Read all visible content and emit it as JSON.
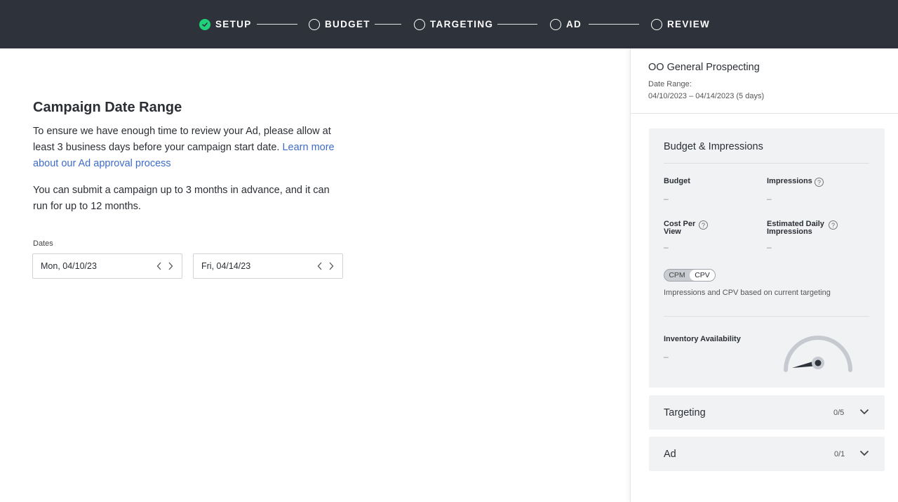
{
  "stepper": {
    "steps": [
      {
        "label": "SETUP",
        "status": "done"
      },
      {
        "label": "BUDGET",
        "status": "pending"
      },
      {
        "label": "TARGETING",
        "status": "pending"
      },
      {
        "label": "AD",
        "status": "pending"
      },
      {
        "label": "REVIEW",
        "status": "pending"
      }
    ]
  },
  "main": {
    "title": "Campaign Date Range",
    "para1_text": "To ensure we have enough time to review your Ad, please allow at least 3 business days before your campaign start date.",
    "para1_link": "Learn more about our Ad approval process",
    "para2": "You can submit a campaign up to 3 months in advance, and it can run for up to 12 months.",
    "dates_label": "Dates",
    "start_date": "Mon, 04/10/23",
    "end_date": "Fri, 04/14/23"
  },
  "summary": {
    "campaign_name": "OO General Prospecting",
    "date_range_label": "Date Range:",
    "date_range_value": "04/10/2023 – 04/14/2023 (5 days)",
    "budget_card": {
      "title": "Budget & Impressions",
      "budget_label": "Budget",
      "budget_value": "–",
      "impressions_label": "Impressions",
      "impressions_value": "–",
      "cpv_label_line1": "Cost Per",
      "cpv_label_line2": "View",
      "cpv_value": "–",
      "edi_label_line1": "Estimated Daily",
      "edi_label_line2": "Impressions",
      "edi_value": "–",
      "toggle_options": [
        "CPM",
        "CPV"
      ],
      "toggle_selected": "CPV",
      "note": "Impressions and CPV based on current targeting",
      "inventory_label": "Inventory Availability",
      "inventory_value": "–"
    },
    "targeting": {
      "title": "Targeting",
      "count": "0/5"
    },
    "ad": {
      "title": "Ad",
      "count": "0/1"
    }
  },
  "colors": {
    "topbar": "#2e323b",
    "step_done": "#1fd27a",
    "link": "#3d6bc9",
    "card_bg": "#f1f2f4"
  },
  "icons": {
    "step_done": "check-icon",
    "step_pending": "circle-icon",
    "date_prev": "chevron-left-icon",
    "date_next": "chevron-right-icon",
    "help": "question-circle-icon",
    "expand": "chevron-down-icon",
    "gauge": "gauge-icon"
  }
}
